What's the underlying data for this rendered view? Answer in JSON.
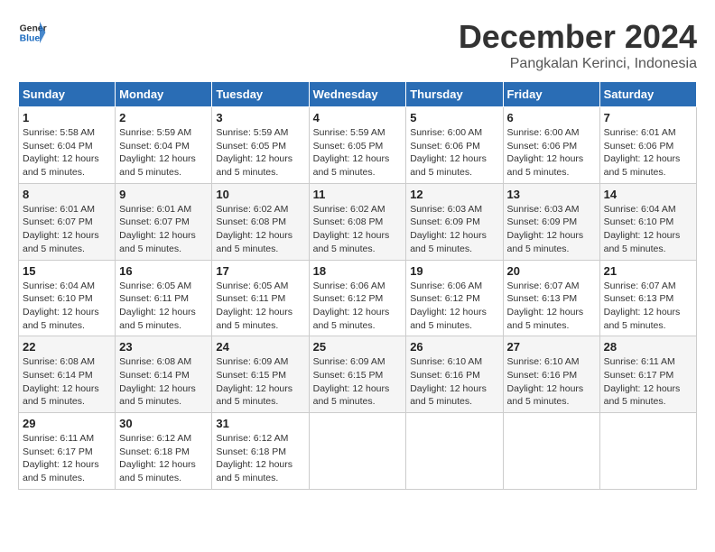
{
  "logo": {
    "text_general": "General",
    "text_blue": "Blue"
  },
  "header": {
    "month": "December 2024",
    "location": "Pangkalan Kerinci, Indonesia"
  },
  "weekdays": [
    "Sunday",
    "Monday",
    "Tuesday",
    "Wednesday",
    "Thursday",
    "Friday",
    "Saturday"
  ],
  "weeks": [
    [
      {
        "day": "1",
        "sunrise": "5:58 AM",
        "sunset": "6:04 PM",
        "daylight": "12 hours and 5 minutes."
      },
      {
        "day": "2",
        "sunrise": "5:59 AM",
        "sunset": "6:04 PM",
        "daylight": "12 hours and 5 minutes."
      },
      {
        "day": "3",
        "sunrise": "5:59 AM",
        "sunset": "6:05 PM",
        "daylight": "12 hours and 5 minutes."
      },
      {
        "day": "4",
        "sunrise": "5:59 AM",
        "sunset": "6:05 PM",
        "daylight": "12 hours and 5 minutes."
      },
      {
        "day": "5",
        "sunrise": "6:00 AM",
        "sunset": "6:06 PM",
        "daylight": "12 hours and 5 minutes."
      },
      {
        "day": "6",
        "sunrise": "6:00 AM",
        "sunset": "6:06 PM",
        "daylight": "12 hours and 5 minutes."
      },
      {
        "day": "7",
        "sunrise": "6:01 AM",
        "sunset": "6:06 PM",
        "daylight": "12 hours and 5 minutes."
      }
    ],
    [
      {
        "day": "8",
        "sunrise": "6:01 AM",
        "sunset": "6:07 PM",
        "daylight": "12 hours and 5 minutes."
      },
      {
        "day": "9",
        "sunrise": "6:01 AM",
        "sunset": "6:07 PM",
        "daylight": "12 hours and 5 minutes."
      },
      {
        "day": "10",
        "sunrise": "6:02 AM",
        "sunset": "6:08 PM",
        "daylight": "12 hours and 5 minutes."
      },
      {
        "day": "11",
        "sunrise": "6:02 AM",
        "sunset": "6:08 PM",
        "daylight": "12 hours and 5 minutes."
      },
      {
        "day": "12",
        "sunrise": "6:03 AM",
        "sunset": "6:09 PM",
        "daylight": "12 hours and 5 minutes."
      },
      {
        "day": "13",
        "sunrise": "6:03 AM",
        "sunset": "6:09 PM",
        "daylight": "12 hours and 5 minutes."
      },
      {
        "day": "14",
        "sunrise": "6:04 AM",
        "sunset": "6:10 PM",
        "daylight": "12 hours and 5 minutes."
      }
    ],
    [
      {
        "day": "15",
        "sunrise": "6:04 AM",
        "sunset": "6:10 PM",
        "daylight": "12 hours and 5 minutes."
      },
      {
        "day": "16",
        "sunrise": "6:05 AM",
        "sunset": "6:11 PM",
        "daylight": "12 hours and 5 minutes."
      },
      {
        "day": "17",
        "sunrise": "6:05 AM",
        "sunset": "6:11 PM",
        "daylight": "12 hours and 5 minutes."
      },
      {
        "day": "18",
        "sunrise": "6:06 AM",
        "sunset": "6:12 PM",
        "daylight": "12 hours and 5 minutes."
      },
      {
        "day": "19",
        "sunrise": "6:06 AM",
        "sunset": "6:12 PM",
        "daylight": "12 hours and 5 minutes."
      },
      {
        "day": "20",
        "sunrise": "6:07 AM",
        "sunset": "6:13 PM",
        "daylight": "12 hours and 5 minutes."
      },
      {
        "day": "21",
        "sunrise": "6:07 AM",
        "sunset": "6:13 PM",
        "daylight": "12 hours and 5 minutes."
      }
    ],
    [
      {
        "day": "22",
        "sunrise": "6:08 AM",
        "sunset": "6:14 PM",
        "daylight": "12 hours and 5 minutes."
      },
      {
        "day": "23",
        "sunrise": "6:08 AM",
        "sunset": "6:14 PM",
        "daylight": "12 hours and 5 minutes."
      },
      {
        "day": "24",
        "sunrise": "6:09 AM",
        "sunset": "6:15 PM",
        "daylight": "12 hours and 5 minutes."
      },
      {
        "day": "25",
        "sunrise": "6:09 AM",
        "sunset": "6:15 PM",
        "daylight": "12 hours and 5 minutes."
      },
      {
        "day": "26",
        "sunrise": "6:10 AM",
        "sunset": "6:16 PM",
        "daylight": "12 hours and 5 minutes."
      },
      {
        "day": "27",
        "sunrise": "6:10 AM",
        "sunset": "6:16 PM",
        "daylight": "12 hours and 5 minutes."
      },
      {
        "day": "28",
        "sunrise": "6:11 AM",
        "sunset": "6:17 PM",
        "daylight": "12 hours and 5 minutes."
      }
    ],
    [
      {
        "day": "29",
        "sunrise": "6:11 AM",
        "sunset": "6:17 PM",
        "daylight": "12 hours and 5 minutes."
      },
      {
        "day": "30",
        "sunrise": "6:12 AM",
        "sunset": "6:18 PM",
        "daylight": "12 hours and 5 minutes."
      },
      {
        "day": "31",
        "sunrise": "6:12 AM",
        "sunset": "6:18 PM",
        "daylight": "12 hours and 5 minutes."
      },
      null,
      null,
      null,
      null
    ]
  ],
  "labels": {
    "sunrise_prefix": "Sunrise: ",
    "sunset_prefix": "Sunset: ",
    "daylight_prefix": "Daylight: "
  }
}
